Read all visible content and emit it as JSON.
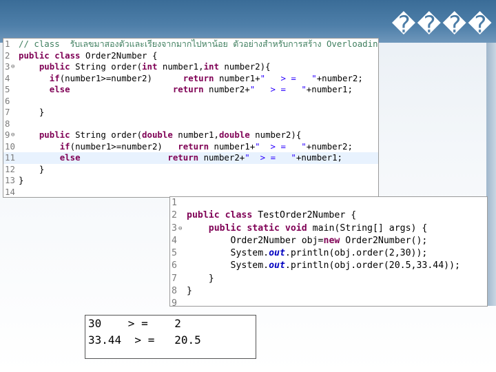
{
  "slide": {
    "title": "����"
  },
  "editor1": {
    "lines": [
      {
        "n": "1",
        "fold": "",
        "parts": [
          {
            "c": "cm",
            "t": "// class  รับเลขมาสองตัวและเรียงจากมากไปหาน้อย ตัวอย่างสำหรับการสร้าง Overloading Method"
          }
        ]
      },
      {
        "n": "2",
        "fold": "",
        "parts": [
          {
            "c": "kw",
            "t": "public class"
          },
          {
            "c": "txt",
            "t": " Order2Number {"
          }
        ]
      },
      {
        "n": "3",
        "fold": "⊖",
        "parts": [
          {
            "c": "txt",
            "t": "    "
          },
          {
            "c": "kw",
            "t": "public"
          },
          {
            "c": "txt",
            "t": " String order("
          },
          {
            "c": "kw",
            "t": "int"
          },
          {
            "c": "txt",
            "t": " number1,"
          },
          {
            "c": "kw",
            "t": "int"
          },
          {
            "c": "txt",
            "t": " number2){"
          }
        ]
      },
      {
        "n": "4",
        "fold": "",
        "parts": [
          {
            "c": "txt",
            "t": "      "
          },
          {
            "c": "kw",
            "t": "if"
          },
          {
            "c": "txt",
            "t": "(number1>=number2)      "
          },
          {
            "c": "kw",
            "t": "return"
          },
          {
            "c": "txt",
            "t": " number1+"
          },
          {
            "c": "st",
            "t": "\"   > =   \""
          },
          {
            "c": "txt",
            "t": "+number2;"
          }
        ]
      },
      {
        "n": "5",
        "fold": "",
        "parts": [
          {
            "c": "txt",
            "t": "      "
          },
          {
            "c": "kw",
            "t": "else"
          },
          {
            "c": "txt",
            "t": "                    "
          },
          {
            "c": "kw",
            "t": "return"
          },
          {
            "c": "txt",
            "t": " number2+"
          },
          {
            "c": "st",
            "t": "\"   > =   \""
          },
          {
            "c": "txt",
            "t": "+number1;"
          }
        ]
      },
      {
        "n": "6",
        "fold": "",
        "parts": []
      },
      {
        "n": "7",
        "fold": "",
        "parts": [
          {
            "c": "txt",
            "t": "    }"
          }
        ]
      },
      {
        "n": "8",
        "fold": "",
        "parts": []
      },
      {
        "n": "9",
        "fold": "⊖",
        "parts": [
          {
            "c": "txt",
            "t": "    "
          },
          {
            "c": "kw",
            "t": "public"
          },
          {
            "c": "txt",
            "t": " String order("
          },
          {
            "c": "kw",
            "t": "double"
          },
          {
            "c": "txt",
            "t": " number1,"
          },
          {
            "c": "kw",
            "t": "double"
          },
          {
            "c": "txt",
            "t": " number2){"
          }
        ]
      },
      {
        "n": "10",
        "fold": "",
        "parts": [
          {
            "c": "txt",
            "t": "        "
          },
          {
            "c": "kw",
            "t": "if"
          },
          {
            "c": "txt",
            "t": "(number1>=number2)   "
          },
          {
            "c": "kw",
            "t": "return"
          },
          {
            "c": "txt",
            "t": " number1+"
          },
          {
            "c": "st",
            "t": "\"  > =   \""
          },
          {
            "c": "txt",
            "t": "+number2;"
          }
        ]
      },
      {
        "n": "11",
        "fold": "",
        "hl": true,
        "parts": [
          {
            "c": "txt",
            "t": "        "
          },
          {
            "c": "kw",
            "t": "else"
          },
          {
            "c": "txt",
            "t": "                 "
          },
          {
            "c": "kw",
            "t": "return"
          },
          {
            "c": "txt",
            "t": " number2+"
          },
          {
            "c": "st",
            "t": "\"  > =   \""
          },
          {
            "c": "txt",
            "t": "+number1;"
          }
        ]
      },
      {
        "n": "12",
        "fold": "",
        "parts": [
          {
            "c": "txt",
            "t": "    }"
          }
        ]
      },
      {
        "n": "13",
        "fold": "",
        "parts": [
          {
            "c": "txt",
            "t": "}"
          }
        ]
      },
      {
        "n": "14",
        "fold": "",
        "parts": []
      }
    ]
  },
  "editor2": {
    "lines": [
      {
        "n": "1",
        "fold": "",
        "parts": []
      },
      {
        "n": "2",
        "fold": "",
        "parts": [
          {
            "c": "kw",
            "t": "public class"
          },
          {
            "c": "txt",
            "t": " TestOrder2Number {"
          }
        ]
      },
      {
        "n": "3",
        "fold": "⊖",
        "parts": [
          {
            "c": "txt",
            "t": "    "
          },
          {
            "c": "kw",
            "t": "public static void"
          },
          {
            "c": "txt",
            "t": " main(String[] args) {"
          }
        ]
      },
      {
        "n": "4",
        "fold": "",
        "parts": [
          {
            "c": "txt",
            "t": "        Order2Number obj="
          },
          {
            "c": "kw",
            "t": "new"
          },
          {
            "c": "txt",
            "t": " Order2Number();"
          }
        ]
      },
      {
        "n": "5",
        "fold": "",
        "parts": [
          {
            "c": "txt",
            "t": "        System."
          },
          {
            "c": "fd",
            "t": "out"
          },
          {
            "c": "txt",
            "t": ".println(obj.order(2,30));"
          }
        ]
      },
      {
        "n": "6",
        "fold": "",
        "parts": [
          {
            "c": "txt",
            "t": "        System."
          },
          {
            "c": "fd",
            "t": "out"
          },
          {
            "c": "txt",
            "t": ".println(obj.order(20.5,33.44));"
          }
        ]
      },
      {
        "n": "7",
        "fold": "",
        "parts": [
          {
            "c": "txt",
            "t": "    }"
          }
        ]
      },
      {
        "n": "8",
        "fold": "",
        "parts": [
          {
            "c": "txt",
            "t": "}"
          }
        ]
      },
      {
        "n": "9",
        "fold": "",
        "parts": []
      }
    ]
  },
  "console": {
    "lines": [
      "30    > =    2",
      "33.44  > =   20.5"
    ]
  }
}
